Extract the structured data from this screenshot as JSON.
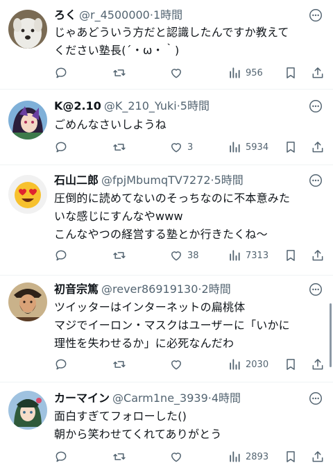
{
  "tweets": [
    {
      "name": "ろく",
      "handle": "@r_4500000",
      "sep": "·",
      "time": "1時間",
      "text": "じゃあどういう方だと認識したんですか教えて\nください塾長(´・ω・｀)",
      "stats": {
        "replies": "",
        "retweets": "",
        "likes": "",
        "views": "956"
      }
    },
    {
      "name": "K@2.10",
      "handle": "@K_210_Yuki",
      "sep": "·",
      "time": "5時間",
      "text": "ごめんなさいしようね",
      "stats": {
        "replies": "",
        "retweets": "",
        "likes": "3",
        "views": "5934"
      }
    },
    {
      "name": "石山二郎",
      "handle": "@fpjMbumqTV7272",
      "sep": "·",
      "time": "5時間",
      "text": "圧倒的に読めてないのそっちなのに不本意みた\nいな感じにすんなやwww\nこんなやつの経営する塾とか行きたくね〜",
      "stats": {
        "replies": "",
        "retweets": "",
        "likes": "38",
        "views": "7313"
      }
    },
    {
      "name": "初音宗篤",
      "handle": "@rever86919130",
      "sep": "·",
      "time": "2時間",
      "text": "ツイッターはインターネットの扁桃体\nマジでイーロン・マスクはユーザーに「いかに\n理性を失わせるか」に必死なんだわ",
      "stats": {
        "replies": "",
        "retweets": "",
        "likes": "",
        "views": "2030"
      }
    },
    {
      "name": "カーマイン",
      "handle": "@Carm1ne_3939",
      "sep": "·",
      "time": "4時間",
      "text": "面白すぎてフォローした()\n朝から笑わせてくれてありがとう",
      "stats": {
        "replies": "",
        "retweets": "",
        "likes": "",
        "views": "2893"
      }
    }
  ],
  "icons": {
    "reply": "speech-bubble-icon",
    "retweet": "retweet-icon",
    "like": "heart-icon",
    "views": "bar-chart-icon",
    "bookmark": "bookmark-icon",
    "share": "share-icon",
    "more": "more-dots-icon"
  },
  "colors": {
    "text": "#0f1419",
    "muted": "#536471",
    "divider": "#eff3f4"
  }
}
